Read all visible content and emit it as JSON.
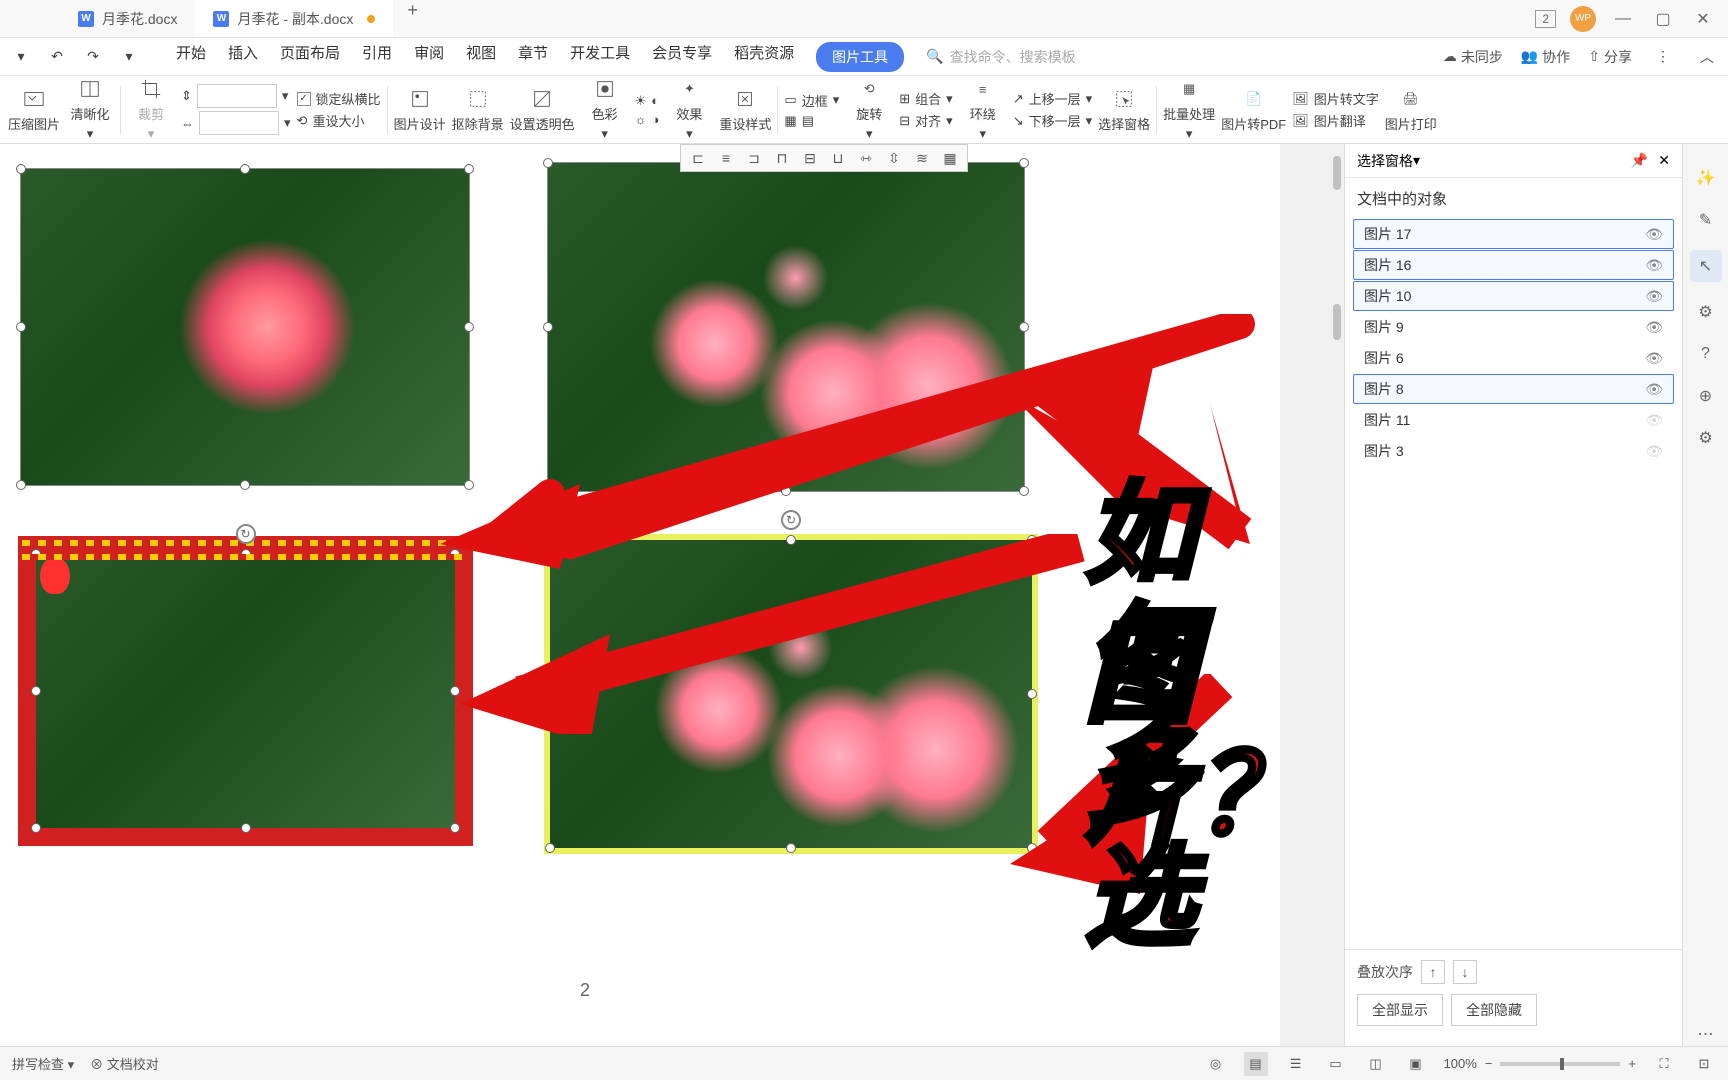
{
  "titlebar": {
    "tab1": "月季花.docx",
    "tab2": "月季花 - 副本.docx",
    "badge": "2",
    "avatar": "WP"
  },
  "menubar": {
    "items": [
      "开始",
      "插入",
      "页面布局",
      "引用",
      "审阅",
      "视图",
      "章节",
      "开发工具",
      "会员专享",
      "稻壳资源"
    ],
    "pill": "图片工具",
    "search_ph": "查找命令、搜索模板",
    "sync": "未同步",
    "collab": "协作",
    "share": "分享"
  },
  "ribbon": {
    "compress": "压缩图片",
    "clarity": "清晰化",
    "crop": "裁剪",
    "lock_ratio": "锁定纵横比",
    "reset_size": "重设大小",
    "pic_design": "图片设计",
    "remove_bg": "抠除背景",
    "set_trans": "设置透明色",
    "color": "色彩",
    "effect": "效果",
    "reset_style": "重设样式",
    "border": "边框",
    "rotate": "旋转",
    "combine": "组合",
    "align": "对齐",
    "wrap": "环绕",
    "up_layer": "上移一层",
    "down_layer": "下移一层",
    "sel_pane": "选择窗格",
    "batch": "批量处理",
    "to_pdf": "图片转PDF",
    "to_text": "图片转文字",
    "translate": "图片翻译",
    "print": "图片打印"
  },
  "panel": {
    "title": "选择窗格",
    "section": "文档中的对象",
    "items": [
      {
        "label": "图片 17",
        "sel": true
      },
      {
        "label": "图片 16",
        "sel": true
      },
      {
        "label": "图片 10",
        "sel": true
      },
      {
        "label": "图片 9",
        "sel": false
      },
      {
        "label": "图片 6",
        "sel": false
      },
      {
        "label": "图片 8",
        "sel": true
      },
      {
        "label": "图片 11",
        "sel": false,
        "dim": true
      },
      {
        "label": "图片 3",
        "sel": false,
        "dim": true
      }
    ],
    "stack": "叠放次序",
    "show_all": "全部显示",
    "hide_all": "全部隐藏"
  },
  "overlay": {
    "line1": "如何多选",
    "line2": "图片？"
  },
  "status": {
    "spell": "拼写检查",
    "proof": "文档校对",
    "zoom": "100%"
  },
  "page_num": "2"
}
